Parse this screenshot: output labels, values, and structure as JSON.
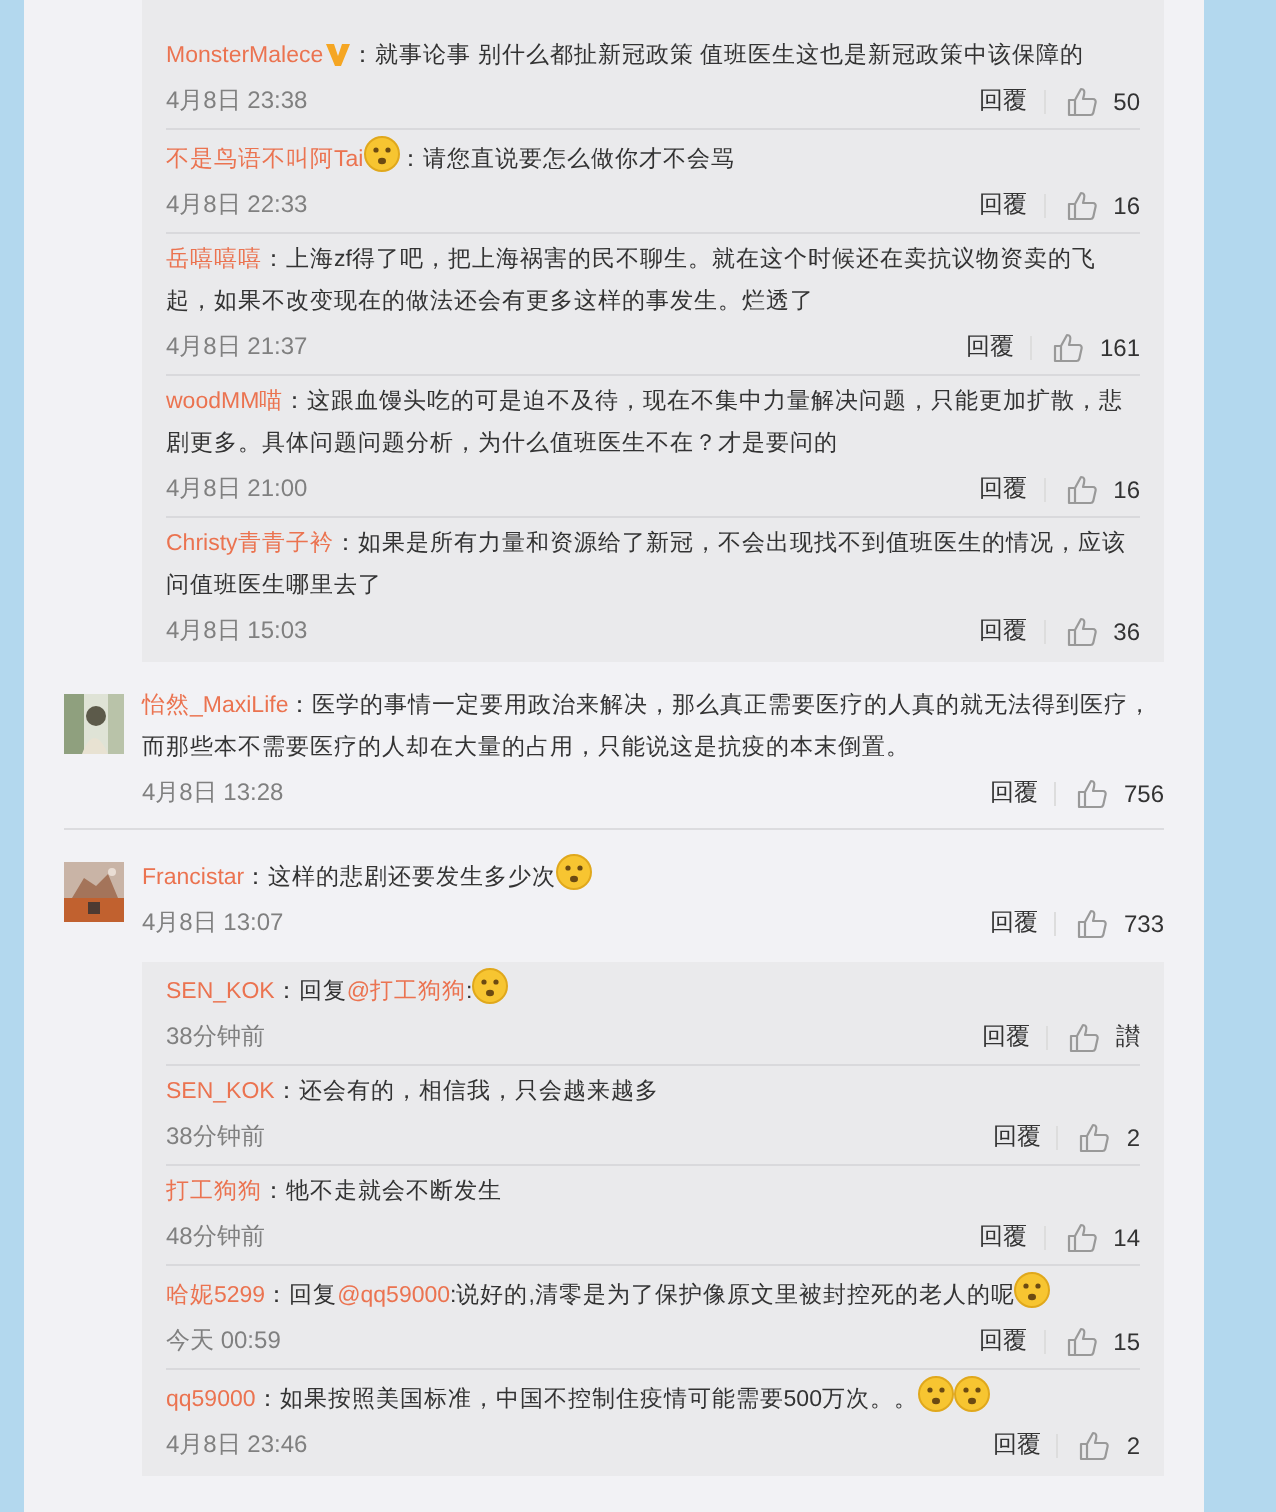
{
  "threads": [
    {
      "kind": "replies",
      "replies": [
        {
          "user": "MonsterMalece",
          "vip": true,
          "parts": [
            {
              "kind": "text",
              "text": "：就事论事 别什么都扯新冠政策 值班医生这也是新冠政策中该保障的"
            }
          ],
          "time": "4月8日 23:38",
          "reply": "回覆",
          "likes": "50"
        },
        {
          "user": "不是鸟语不叫阿Tai",
          "vip": false,
          "parts": [
            {
              "kind": "emoji"
            },
            {
              "kind": "text",
              "text": "：请您直说要怎么做你才不会骂"
            }
          ],
          "time": "4月8日 22:33",
          "reply": "回覆",
          "likes": "16"
        },
        {
          "user": "岳嘻嘻嘻",
          "vip": false,
          "parts": [
            {
              "kind": "text",
              "text": "：上海zf得了吧，把上海祸害的民不聊生。就在这个时候还在卖抗议物资卖的飞起，如果不改变现在的做法还会有更多这样的事发生。烂透了"
            }
          ],
          "time": "4月8日 21:37",
          "reply": "回覆",
          "likes": "161"
        },
        {
          "user": "woodMM喵",
          "vip": false,
          "parts": [
            {
              "kind": "text",
              "text": "：这跟血馒头吃的可是迫不及待，现在不集中力量解决问题，只能更加扩散，悲剧更多。具体问题问题分析，为什么值班医生不在？才是要问的"
            }
          ],
          "time": "4月8日 21:00",
          "reply": "回覆",
          "likes": "16"
        },
        {
          "user": "Christy青青子衿",
          "vip": false,
          "parts": [
            {
              "kind": "text",
              "text": "：如果是所有力量和资源给了新冠，不会出现找不到值班医生的情况，应该问值班医生哪里去了"
            }
          ],
          "time": "4月8日 15:03",
          "reply": "回覆",
          "likes": "36"
        }
      ]
    },
    {
      "kind": "comment",
      "user": "怡然_MaxiLife",
      "vip": false,
      "parts": [
        {
          "kind": "text",
          "text": "：医学的事情一定要用政治来解决，那么真正需要医疗的人真的就无法得到医疗，而那些本不需要医疗的人却在大量的占用，只能说这是抗疫的本末倒置。"
        }
      ],
      "time": "4月8日 13:28",
      "reply": "回覆",
      "likes": "756"
    },
    {
      "kind": "comment",
      "user": "Francistar",
      "vip": false,
      "parts": [
        {
          "kind": "text",
          "text": "：这样的悲剧还要发生多少次"
        },
        {
          "kind": "emoji"
        }
      ],
      "time": "4月8日 13:07",
      "reply": "回覆",
      "likes": "733",
      "replies": [
        {
          "user": "SEN_KOK",
          "vip": false,
          "parts": [
            {
              "kind": "text",
              "text": "：回复"
            },
            {
              "kind": "mention",
              "text": "@打工狗狗"
            },
            {
              "kind": "text",
              "text": ":"
            },
            {
              "kind": "emoji"
            }
          ],
          "time": "38分钟前",
          "reply": "回覆",
          "likes": "讃"
        },
        {
          "user": "SEN_KOK",
          "vip": false,
          "parts": [
            {
              "kind": "text",
              "text": "：还会有的，相信我，只会越来越多"
            }
          ],
          "time": "38分钟前",
          "reply": "回覆",
          "likes": "2"
        },
        {
          "user": "打工狗狗",
          "vip": false,
          "parts": [
            {
              "kind": "text",
              "text": "：牠不走就会不断发生"
            }
          ],
          "time": "48分钟前",
          "reply": "回覆",
          "likes": "14"
        },
        {
          "user": "哈妮5299",
          "vip": false,
          "parts": [
            {
              "kind": "text",
              "text": "：回复"
            },
            {
              "kind": "mention",
              "text": "@qq59000"
            },
            {
              "kind": "text",
              "text": ":说好的,清零是为了保护像原文里被封控死的老人的呢"
            },
            {
              "kind": "emoji"
            }
          ],
          "time": "今天 00:59",
          "reply": "回覆",
          "likes": "15"
        },
        {
          "user": "qq59000",
          "vip": false,
          "parts": [
            {
              "kind": "text",
              "text": "：如果按照美国标准，中国不控制住疫情可能需要500万次。。"
            },
            {
              "kind": "emoji"
            },
            {
              "kind": "emoji"
            }
          ],
          "time": "4月8日 23:46",
          "reply": "回覆",
          "likes": "2"
        }
      ]
    }
  ]
}
